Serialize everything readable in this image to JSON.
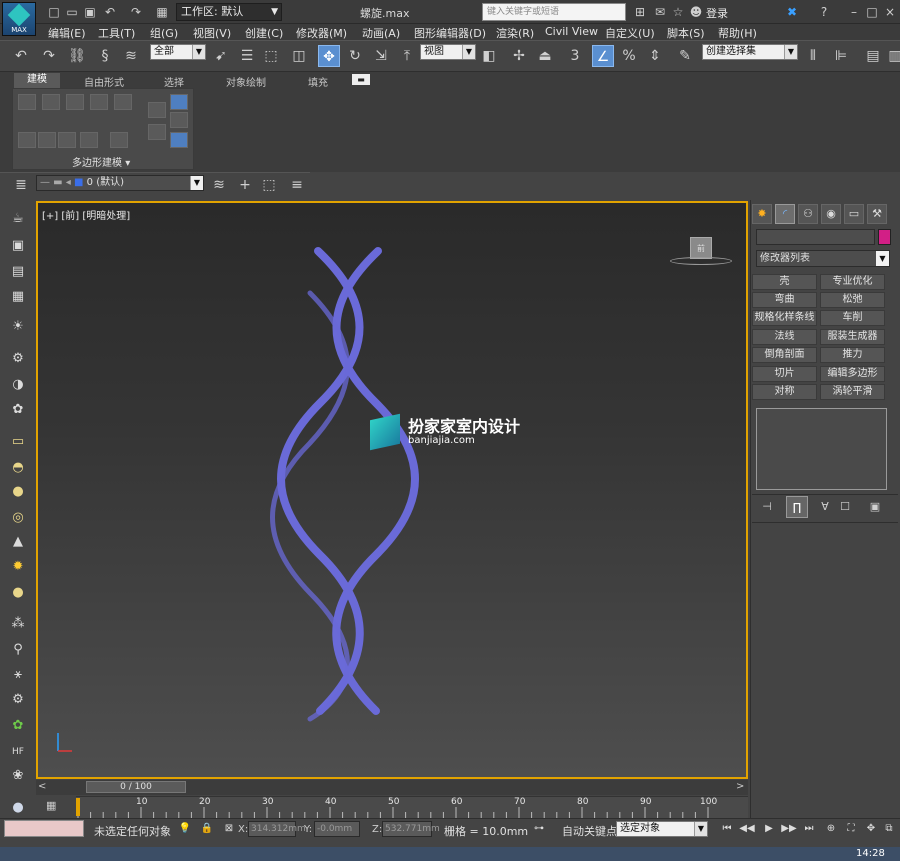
{
  "title_bar": {
    "logo_label": "MAX",
    "workspace": "工作区: 默认",
    "filename": "螺旋.max",
    "search_placeholder": "键入关键字或短语",
    "login": "登录"
  },
  "menu": [
    "编辑(E)",
    "工具(T)",
    "组(G)",
    "视图(V)",
    "创建(C)",
    "修改器(M)",
    "动画(A)",
    "图形编辑器(D)",
    "渲染(R)",
    "Civil View",
    "自定义(U)",
    "脚本(S)",
    "帮助(H)"
  ],
  "toolbar": {
    "selection_filter": "全部",
    "ref_coord": "视图",
    "angle_snap_label": "3",
    "percent_label": "%",
    "named_selection": "创建选择集"
  },
  "ribbon": {
    "tabs": [
      "建模",
      "自由形式",
      "选择",
      "对象绘制",
      "填充"
    ],
    "active_tab": "建模",
    "panel_label": "多边形建模"
  },
  "layer": {
    "current_layer": "0 (默认)"
  },
  "viewport": {
    "label": "[+] [前] [明暗处理]",
    "viewcube_label": "前",
    "watermark_title": "扮家家室内设计",
    "watermark_sub": "banjiajia.com",
    "helix_color": "#6a6ad8",
    "border_color": "#e2a300"
  },
  "command_panel": {
    "color_swatch": "#d21f86",
    "modifier_list": "修改器列表",
    "modifiers": [
      "壳",
      "专业优化",
      "弯曲",
      "松弛",
      "规格化样条线",
      "车削",
      "法线",
      "服装生成器",
      "倒角剖面",
      "推力",
      "切片",
      "编辑多边形",
      "对称",
      "涡轮平滑"
    ]
  },
  "timeline": {
    "frame_display": "0 / 100",
    "ticks": [
      "10",
      "20",
      "30",
      "40",
      "50",
      "60",
      "70",
      "80",
      "90",
      "100"
    ]
  },
  "status": {
    "selection": "未选定任何对象",
    "x_label": "X:",
    "x_value": "314.312mm",
    "y_label": "Y:",
    "y_value": "-0.0mm",
    "z_label": "Z:",
    "z_value": "532.771mm",
    "grid": "栅格 = 10.0mm",
    "auto_key": "自动关键点",
    "key_filter": "选定对象",
    "clock": "14:28"
  }
}
